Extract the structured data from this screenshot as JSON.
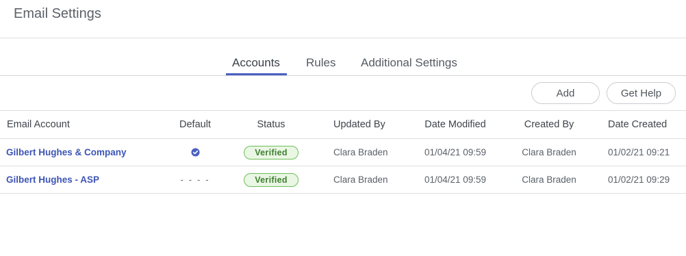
{
  "header": {
    "title": "Email Settings"
  },
  "tabs": [
    {
      "label": "Accounts",
      "active": true
    },
    {
      "label": "Rules",
      "active": false
    },
    {
      "label": "Additional Settings",
      "active": false
    }
  ],
  "toolbar": {
    "add_label": "Add",
    "help_label": "Get Help"
  },
  "table": {
    "columns": [
      "Email Account",
      "Default",
      "Status",
      "Updated By",
      "Date Modified",
      "Created By",
      "Date Created"
    ],
    "rows": [
      {
        "account": "Gilbert Hughes & Company",
        "default_icon": "check-circle-icon",
        "status": "Verified",
        "updated_by": "Clara Braden",
        "date_modified": "01/04/21 09:59",
        "created_by": "Clara Braden",
        "date_created": "01/02/21 09:21"
      },
      {
        "account": "Gilbert Hughes - ASP",
        "default_text": "- - - -",
        "status": "Verified",
        "updated_by": "Clara Braden",
        "date_modified": "01/04/21 09:59",
        "created_by": "Clara Braden",
        "date_created": "01/02/21 09:29"
      }
    ]
  },
  "colors": {
    "accent": "#4a5fc1",
    "link": "#3d55b5",
    "verified_border": "#6cbf5a",
    "verified_bg": "#eaf7e4"
  }
}
